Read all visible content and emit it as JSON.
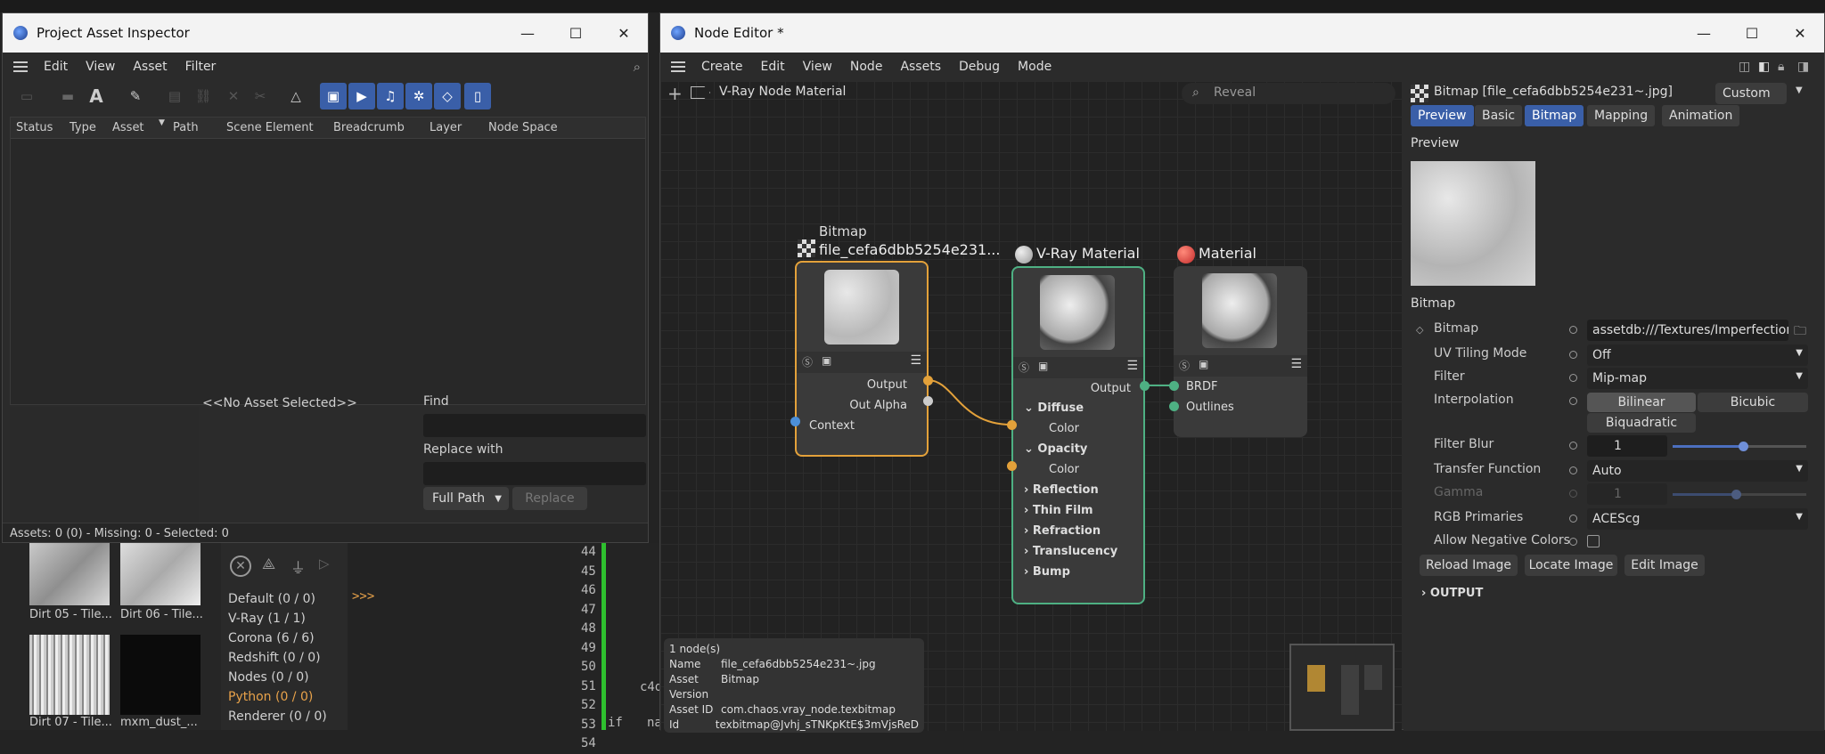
{
  "background": {
    "code_lines": [
      "44",
      "45",
      "46",
      "47",
      "48",
      "49",
      "50",
      "51",
      "52",
      "53",
      "54"
    ],
    "code_bits": [
      "c4d",
      "if",
      "name"
    ],
    "prompt": ">>>",
    "log_filters": [
      "Default (0 / 0)",
      "V-Ray (1 / 1)",
      "Corona (6 / 6)",
      "Redshift (0 / 0)",
      "Nodes (0 / 0)",
      "Python (0 / 0)",
      "Renderer (0 / 0)"
    ],
    "thumbs": [
      {
        "label": "Dirt 05 - Tile..."
      },
      {
        "label": "Dirt 06 - Tile..."
      },
      {
        "label": "Dirt 07 - Tile..."
      },
      {
        "label": "mxm_dust_..."
      }
    ]
  },
  "asset_inspector": {
    "title": "Project Asset Inspector",
    "menu": [
      "Edit",
      "View",
      "Asset",
      "Filter"
    ],
    "columns": [
      "Status",
      "Type",
      "Asset",
      "Path",
      "Scene Element",
      "Breadcrumb",
      "Layer",
      "Node Space"
    ],
    "no_asset": "<<No Asset Selected>>",
    "find_label": "Find",
    "replace_label": "Replace with",
    "path_mode": "Full Path",
    "replace_button": "Replace",
    "status": "Assets: 0 (0) - Missing: 0 - Selected: 0"
  },
  "node_editor": {
    "title": "Node Editor *",
    "menu": [
      "Create",
      "Edit",
      "View",
      "Node",
      "Assets",
      "Debug",
      "Mode"
    ],
    "breadcrumb": "V-Ray Node Material",
    "reveal_placeholder": "Reveal",
    "nodes": {
      "bitmap": {
        "type": "Bitmap",
        "name": "file_cefa6dbb5254e231...",
        "ports_out": [
          "Output",
          "Out Alpha"
        ],
        "ports_in": [
          "Context"
        ]
      },
      "vray": {
        "name": "V-Ray Material",
        "output": "Output",
        "sections": [
          "Diffuse",
          "Opacity",
          "Reflection",
          "Thin Film",
          "Refraction",
          "Translucency",
          "Bump"
        ],
        "sub": "Color"
      },
      "material": {
        "name": "Material",
        "ports": [
          "BRDF",
          "Outlines"
        ]
      }
    },
    "info": {
      "count": "1 node(s)",
      "rows": [
        {
          "k": "Name",
          "v": "file_cefa6dbb5254e231~.jpg"
        },
        {
          "k": "Asset",
          "v": "Bitmap"
        },
        {
          "k": "Version",
          "v": ""
        },
        {
          "k": "Asset ID",
          "v": "com.chaos.vray_node.texbitmap"
        },
        {
          "k": "Id",
          "v": "texbitmap@Jvhj_sTNKpKtE$3mVjsReD"
        }
      ]
    }
  },
  "attributes": {
    "title": "Bitmap [file_cefa6dbb5254e231~.jpg]",
    "mode": "Custom",
    "tabs": [
      "Preview",
      "Basic",
      "Bitmap",
      "Mapping",
      "Animation"
    ],
    "preview_heading": "Preview",
    "bitmap_heading": "Bitmap",
    "bitmap_label": "Bitmap",
    "bitmap_value": "assetdb:///Textures/Imperfections/I",
    "uv_label": "UV Tiling Mode",
    "uv_value": "Off",
    "filter_label": "Filter",
    "filter_value": "Mip-map",
    "interp_label": "Interpolation",
    "interp_options": [
      "Bilinear",
      "Bicubic",
      "Biquadratic"
    ],
    "blur_label": "Filter Blur",
    "blur_value": "1",
    "transfer_label": "Transfer Function",
    "transfer_value": "Auto",
    "gamma_label": "Gamma",
    "gamma_value": "1",
    "rgb_label": "RGB Primaries",
    "rgb_value": "ACEScg",
    "neg_label": "Allow Negative Colors",
    "buttons": [
      "Reload Image",
      "Locate Image",
      "Edit Image"
    ],
    "output_heading": "OUTPUT"
  }
}
